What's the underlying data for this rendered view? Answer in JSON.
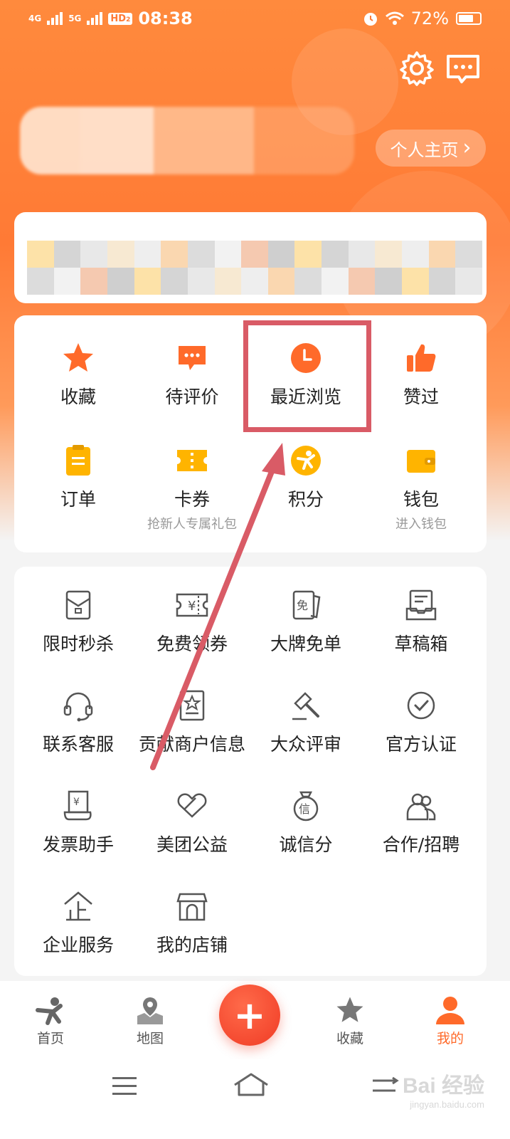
{
  "status_bar": {
    "net1": "4G",
    "net2": "5G",
    "hd": "HD",
    "hd_sub": "2",
    "time": "08:38",
    "battery": "72%",
    "battery_level": 0.72
  },
  "header": {
    "homepage_label": "个人主页",
    "homepage_chevron": "›"
  },
  "quick_grid": [
    {
      "label": "收藏",
      "sub": "",
      "icon": "star-icon"
    },
    {
      "label": "待评价",
      "sub": "",
      "icon": "comment-icon"
    },
    {
      "label": "最近浏览",
      "sub": "",
      "icon": "clock-icon"
    },
    {
      "label": "赞过",
      "sub": "",
      "icon": "thumbs-up-icon"
    },
    {
      "label": "订单",
      "sub": "",
      "icon": "order-icon"
    },
    {
      "label": "卡券",
      "sub": "抢新人专属礼包",
      "icon": "ticket-icon"
    },
    {
      "label": "积分",
      "sub": "",
      "icon": "points-icon"
    },
    {
      "label": "钱包",
      "sub": "进入钱包",
      "icon": "wallet-icon"
    }
  ],
  "services": [
    {
      "label": "限时秒杀",
      "icon": "flash-sale-icon"
    },
    {
      "label": "免费领券",
      "icon": "coupon-icon"
    },
    {
      "label": "大牌免单",
      "icon": "free-order-icon"
    },
    {
      "label": "草稿箱",
      "icon": "drafts-icon"
    },
    {
      "label": "联系客服",
      "icon": "headset-icon"
    },
    {
      "label": "贡献商户信息",
      "icon": "merchant-info-icon"
    },
    {
      "label": "大众评审",
      "icon": "gavel-icon"
    },
    {
      "label": "官方认证",
      "icon": "check-circle-icon"
    },
    {
      "label": "发票助手",
      "icon": "invoice-icon"
    },
    {
      "label": "美团公益",
      "icon": "charity-icon"
    },
    {
      "label": "诚信分",
      "icon": "credit-icon"
    },
    {
      "label": "合作/招聘",
      "icon": "cooperation-icon"
    },
    {
      "label": "企业服务",
      "icon": "enterprise-icon"
    },
    {
      "label": "我的店铺",
      "icon": "shop-icon"
    }
  ],
  "bottom_nav": [
    {
      "label": "首页",
      "icon": "home-mascot-icon",
      "active": false
    },
    {
      "label": "地图",
      "icon": "map-icon",
      "active": false
    },
    {
      "label": "收藏",
      "icon": "star-icon",
      "active": false
    },
    {
      "label": "我的",
      "icon": "profile-icon",
      "active": true
    }
  ],
  "fab": {
    "label": "+"
  },
  "watermark": {
    "main": "Bai 经验",
    "sub": "jingyan.baidu.com"
  },
  "colors": {
    "brand": "#ff7a35",
    "highlight": "#d95b66",
    "icon_orange": "#ff6a2a",
    "icon_yellow": "#ffb400"
  }
}
